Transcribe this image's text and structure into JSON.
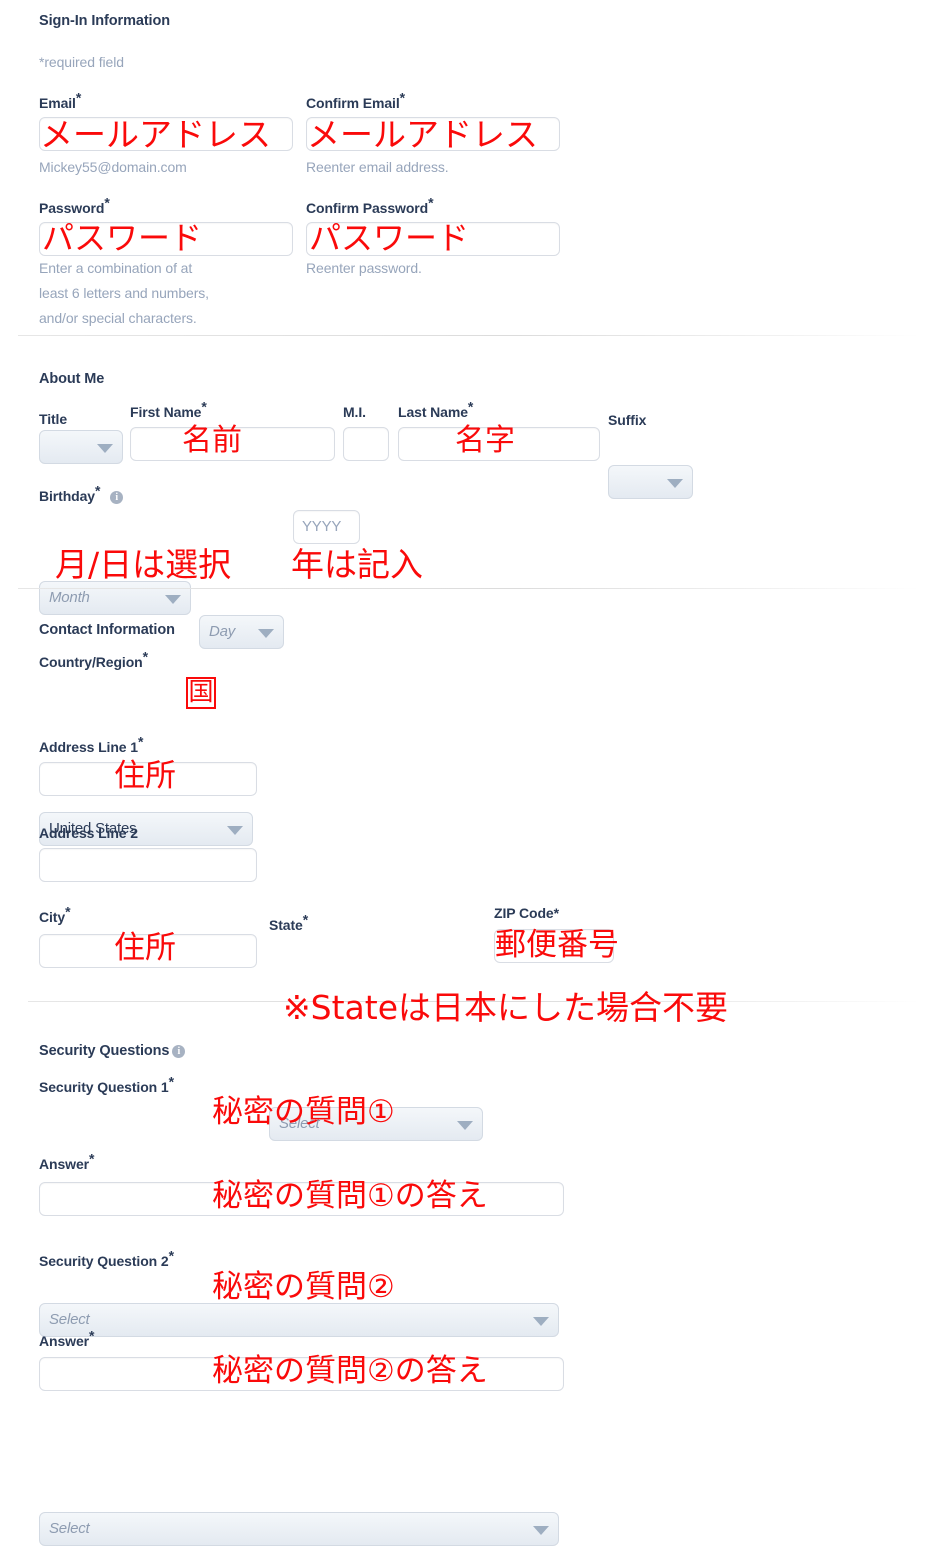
{
  "sections": {
    "signin": {
      "title": "Sign-In Information",
      "required_note": "*required field",
      "fields": {
        "email": {
          "label": "Email",
          "required": "*",
          "value": "",
          "hint": "Mickey55@domain.com",
          "annotation": "メールアドレス"
        },
        "confirm_email": {
          "label": "Confirm Email",
          "required": "*",
          "value": "",
          "hint": "Reenter email address.",
          "annotation": "メールアドレス"
        },
        "password": {
          "label": "Password",
          "required": "*",
          "value": "",
          "hint": "Enter a combination of at\nleast 6 letters and numbers,\nand/or special characters.",
          "annotation": "パスワード"
        },
        "confirm_password": {
          "label": "Confirm Password",
          "required": "*",
          "value": "",
          "hint": "Reenter password.",
          "annotation": "パスワード"
        }
      }
    },
    "about_me": {
      "title": "About Me",
      "fields": {
        "title_select": {
          "label": "Title",
          "value": "",
          "placeholder": ""
        },
        "first_name": {
          "label": "First Name",
          "required": "*",
          "value": "",
          "annotation": "名前"
        },
        "middle_initial": {
          "label": "M.I.",
          "value": ""
        },
        "last_name": {
          "label": "Last Name",
          "required": "*",
          "value": "",
          "annotation": "名字"
        },
        "suffix_select": {
          "label": "Suffix",
          "value": ""
        },
        "birthday": {
          "label": "Birthday",
          "required": "*",
          "info_icon": "info-icon",
          "month_placeholder": "Month",
          "day_placeholder": "Day",
          "year_placeholder": "YYYY",
          "annotation_month_day": "月/日は選択",
          "annotation_year": "年は記入"
        }
      }
    },
    "contact": {
      "title": "Contact Information",
      "fields": {
        "country": {
          "label": "Country/Region",
          "required": "*",
          "value": "United States",
          "annotation": "国"
        },
        "address1": {
          "label": "Address Line 1",
          "required": "*",
          "value": "",
          "annotation": "住所"
        },
        "address2": {
          "label": "Address Line 2",
          "value": ""
        },
        "city": {
          "label": "City",
          "required": "*",
          "value": "",
          "annotation": "住所"
        },
        "state": {
          "label": "State",
          "required": "*",
          "placeholder": "Select",
          "value": ""
        },
        "zip": {
          "label": "ZIP Code*",
          "value": "",
          "annotation": "郵便番号"
        }
      },
      "note_annotation": "※Stateは日本にした場合不要"
    },
    "security": {
      "title": "Security Questions",
      "info_icon": "info-icon",
      "fields": {
        "question1": {
          "label": "Security Question 1",
          "required": "*",
          "placeholder": "Select",
          "annotation": "秘密の質問①"
        },
        "answer1": {
          "label": "Answer",
          "required": "*",
          "value": "",
          "annotation": "秘密の質問①の答え"
        },
        "question2": {
          "label": "Security Question 2",
          "required": "*",
          "placeholder": "Select",
          "annotation": "秘密の質問②"
        },
        "answer2": {
          "label": "Answer",
          "required": "*",
          "value": "",
          "annotation": "秘密の質問②の答え"
        }
      }
    }
  },
  "colors": {
    "heading": "#2b3b57",
    "hint": "#97a5bb",
    "annotation_red": "#fa0a0a",
    "input_border": "#d9dde4",
    "select_bg_top": "#f4f7fa",
    "select_bg_bottom": "#e4eaf1"
  }
}
